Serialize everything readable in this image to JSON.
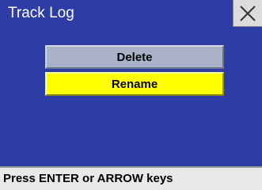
{
  "window": {
    "title": "Track Log",
    "close_icon": "close-icon"
  },
  "menu": {
    "items": [
      {
        "label": "Delete",
        "state": "normal"
      },
      {
        "label": "Rename",
        "state": "highlighted"
      }
    ]
  },
  "status": {
    "text": "Press ENTER or ARROW keys"
  },
  "colors": {
    "background": "#2e3da6",
    "highlight": "#ffff00",
    "button": "#a9b2c7",
    "status_bar": "#e9e9e9"
  }
}
